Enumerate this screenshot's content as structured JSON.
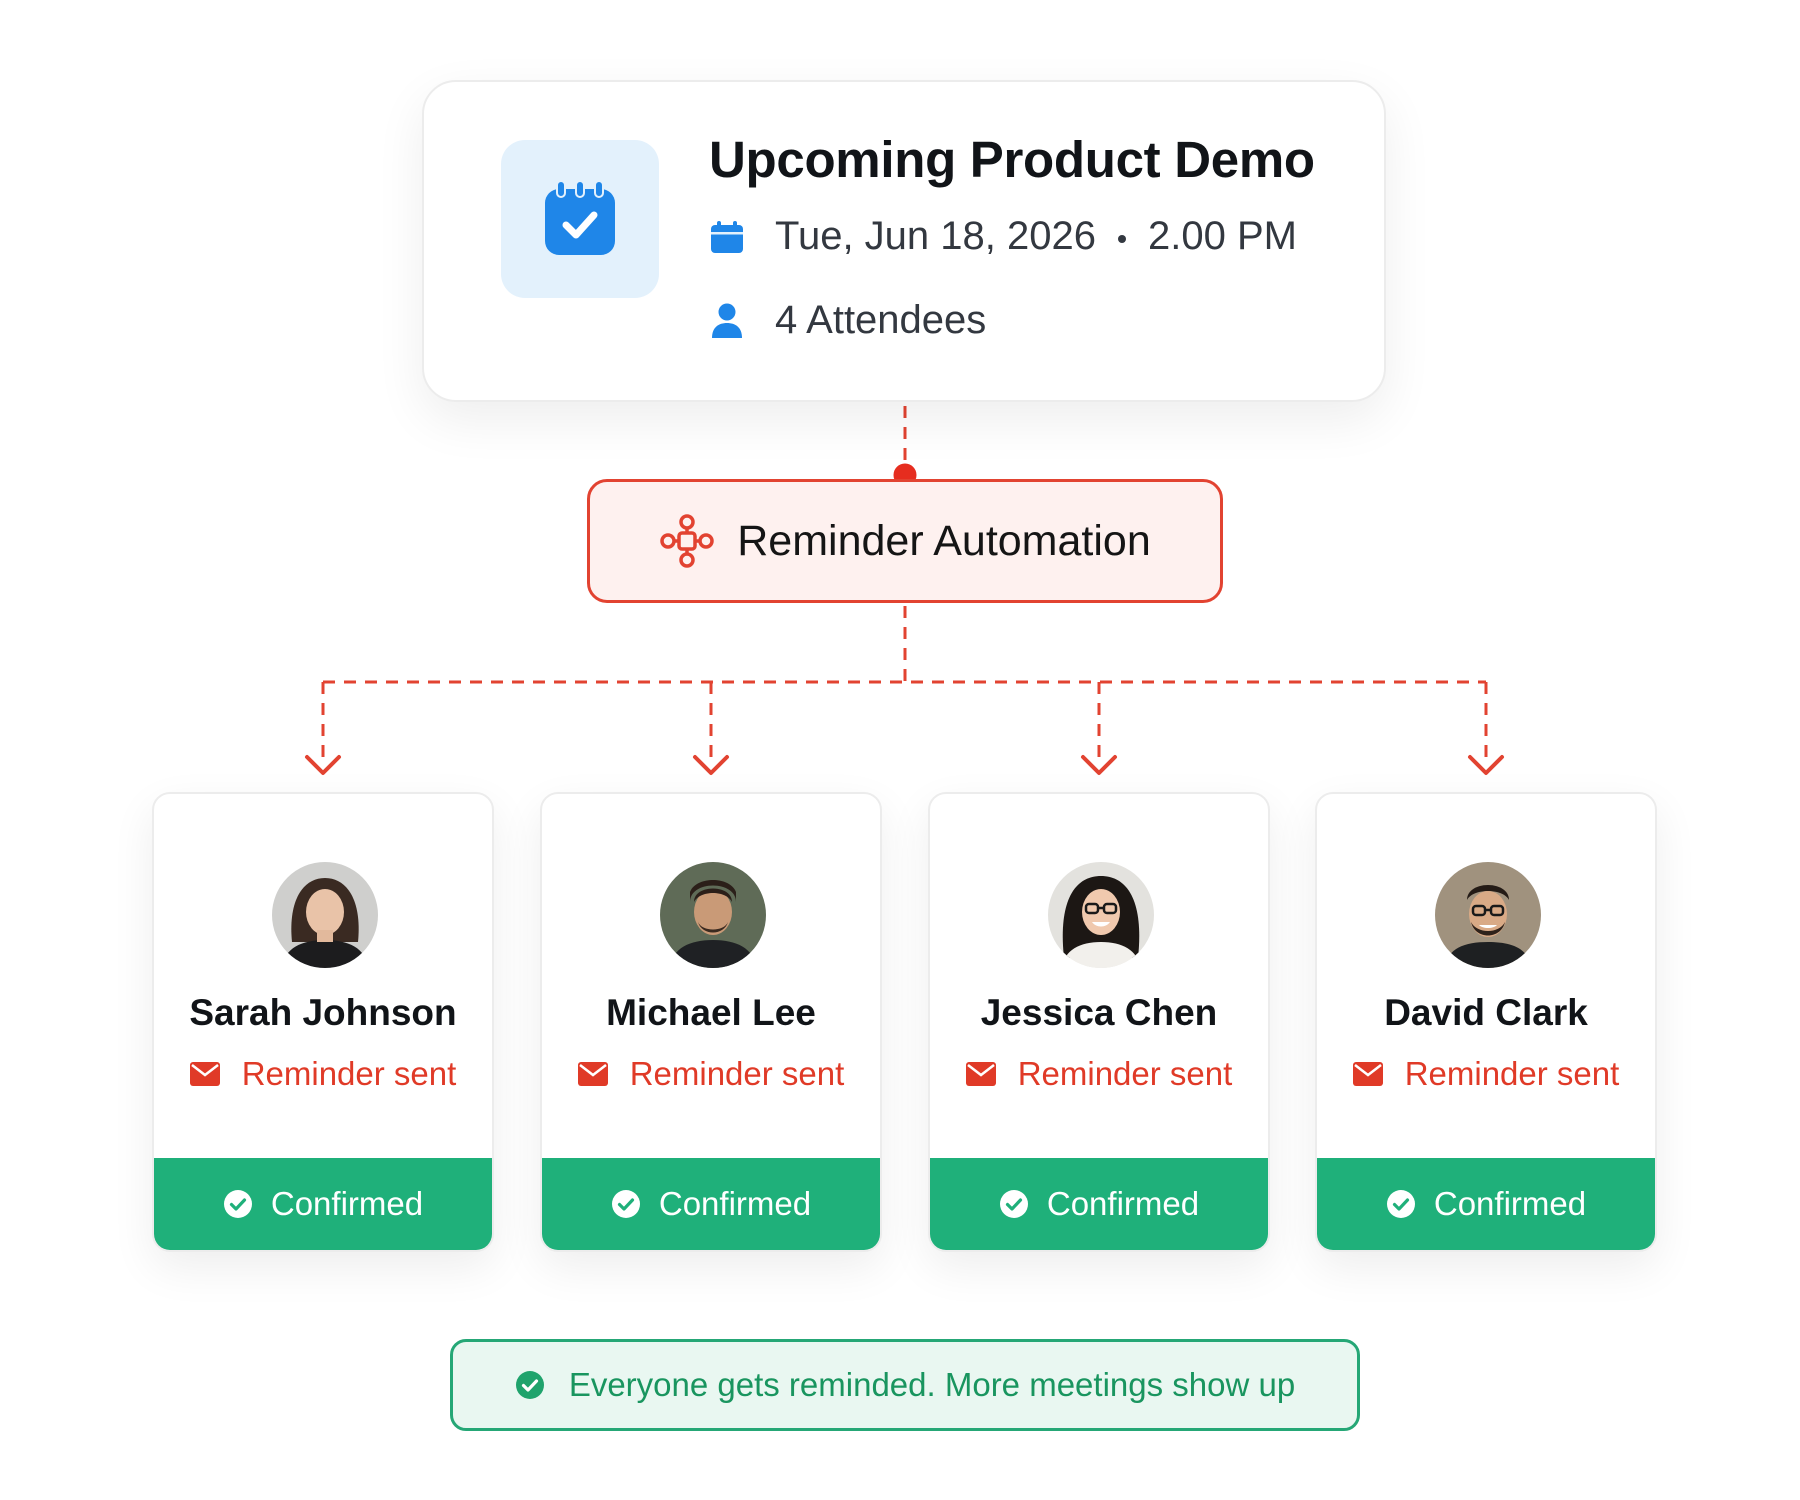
{
  "event": {
    "title": "Upcoming Product Demo",
    "date": "Tue, Jun 18, 2026",
    "time": "2.00 PM",
    "attendees_label": "4 Attendees",
    "icons": {
      "main": "calendar-check-icon",
      "date": "calendar-icon",
      "attendees": "person-icon"
    },
    "colors": {
      "accent": "#1f86e8",
      "icon_bg": "#e3f1fc"
    }
  },
  "automation": {
    "label": "Reminder Automation",
    "icon": "workflow-icon",
    "colors": {
      "border": "#e24331",
      "background": "#fef1ef"
    }
  },
  "attendees": [
    {
      "name": "Sarah Johnson",
      "status": "Reminder sent",
      "confirmation": "Confirmed"
    },
    {
      "name": "Michael Lee",
      "status": "Reminder sent",
      "confirmation": "Confirmed"
    },
    {
      "name": "Jessica Chen",
      "status": "Reminder sent",
      "confirmation": "Confirmed"
    },
    {
      "name": "David Clark",
      "status": "Reminder sent",
      "confirmation": "Confirmed"
    }
  ],
  "attendee_icons": {
    "status": "mail-icon",
    "confirmation": "check-circle-icon"
  },
  "banner": {
    "text": "Everyone gets reminded. More meetings show up",
    "icon": "check-circle-icon"
  },
  "colors": {
    "connector": "#e24331",
    "confirmed": "#1fb07a",
    "reminder": "#e03a27",
    "banner_text": "#19955f"
  }
}
